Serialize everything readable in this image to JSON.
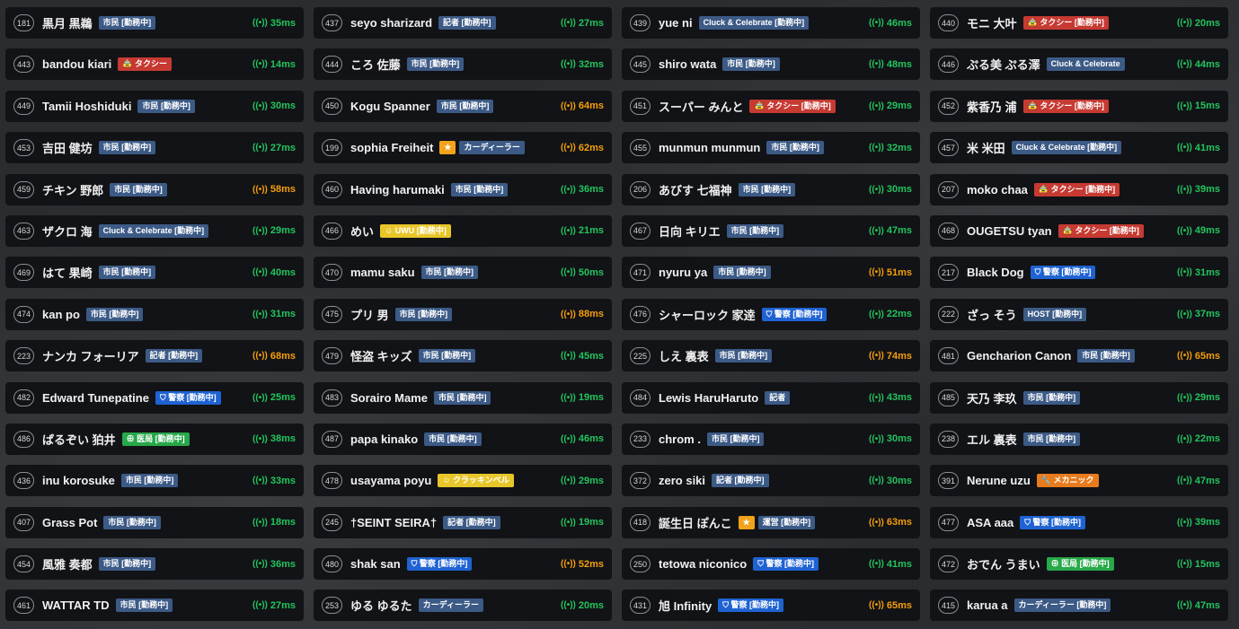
{
  "colors": {
    "bg": "#121316",
    "blue": "#3c5a86",
    "red": "#c63a32",
    "bright": "#1f63d3",
    "green": "#27a84a",
    "yellow": "#e8c62a",
    "orange": "#e87b1d",
    "ping_ok": "#22c55e",
    "ping_warn": "#f59e0b"
  },
  "icons": {
    "signal": "signal-icon",
    "star": "star-icon",
    "taxi": "taxi-icon",
    "shield": "shield-icon",
    "medical": "medical-icon",
    "wrench": "wrench-icon"
  },
  "players": [
    {
      "id": "181",
      "name": "黒月 黒鵜",
      "badges": [
        {
          "text": "市民 [勤務中]",
          "type": "blue"
        }
      ],
      "ping": "35ms",
      "ping_level": "green"
    },
    {
      "id": "437",
      "name": "seyo sharizard",
      "badges": [
        {
          "text": "記者 [勤務中]",
          "type": "blue"
        }
      ],
      "ping": "27ms",
      "ping_level": "green"
    },
    {
      "id": "439",
      "name": "yue ni",
      "badges": [
        {
          "text": "Cluck & Celebrate [勤務中]",
          "type": "blue"
        }
      ],
      "ping": "46ms",
      "ping_level": "green"
    },
    {
      "id": "440",
      "name": "モニ 大叶",
      "badges": [
        {
          "text": "🚖 タクシー [勤務中]",
          "type": "red"
        }
      ],
      "ping": "20ms",
      "ping_level": "green"
    },
    {
      "id": "443",
      "name": "bandou kiari",
      "badges": [
        {
          "text": "🚖 タクシー",
          "type": "red"
        }
      ],
      "ping": "14ms",
      "ping_level": "green"
    },
    {
      "id": "444",
      "name": "ころ 佐藤",
      "badges": [
        {
          "text": "市民 [勤務中]",
          "type": "blue"
        }
      ],
      "ping": "32ms",
      "ping_level": "green"
    },
    {
      "id": "445",
      "name": "shiro wata",
      "badges": [
        {
          "text": "市民 [勤務中]",
          "type": "blue"
        }
      ],
      "ping": "48ms",
      "ping_level": "green"
    },
    {
      "id": "446",
      "name": "ぷる美 ぷる澤",
      "badges": [
        {
          "text": "Cluck & Celebrate",
          "type": "blue"
        }
      ],
      "ping": "44ms",
      "ping_level": "green"
    },
    {
      "id": "449",
      "name": "Tamii Hoshiduki",
      "badges": [
        {
          "text": "市民 [勤務中]",
          "type": "blue"
        }
      ],
      "ping": "30ms",
      "ping_level": "green"
    },
    {
      "id": "450",
      "name": "Kogu Spanner",
      "badges": [
        {
          "text": "市民 [勤務中]",
          "type": "blue"
        }
      ],
      "ping": "64ms",
      "ping_level": "orange"
    },
    {
      "id": "451",
      "name": "スーパー みんと",
      "badges": [
        {
          "text": "🚖 タクシー [勤務中]",
          "type": "red"
        }
      ],
      "ping": "29ms",
      "ping_level": "green"
    },
    {
      "id": "452",
      "name": "紫香乃 浦",
      "badges": [
        {
          "text": "🚖 タクシー [勤務中]",
          "type": "red"
        }
      ],
      "ping": "15ms",
      "ping_level": "green"
    },
    {
      "id": "453",
      "name": "吉田 健坊",
      "badges": [
        {
          "text": "市民 [勤務中]",
          "type": "blue"
        }
      ],
      "ping": "27ms",
      "ping_level": "green"
    },
    {
      "id": "199",
      "name": "sophia Freiheit",
      "badges": [
        {
          "text": "★",
          "type": "gold"
        },
        {
          "text": "カーディーラー",
          "type": "blue"
        }
      ],
      "ping": "62ms",
      "ping_level": "orange"
    },
    {
      "id": "455",
      "name": "munmun munmun",
      "badges": [
        {
          "text": "市民 [勤務中]",
          "type": "blue"
        }
      ],
      "ping": "32ms",
      "ping_level": "green"
    },
    {
      "id": "457",
      "name": "米 米田",
      "badges": [
        {
          "text": "Cluck & Celebrate [勤務中]",
          "type": "blue"
        }
      ],
      "ping": "41ms",
      "ping_level": "green"
    },
    {
      "id": "459",
      "name": "チキン 野郎",
      "badges": [
        {
          "text": "市民 [勤務中]",
          "type": "blue"
        }
      ],
      "ping": "58ms",
      "ping_level": "orange"
    },
    {
      "id": "460",
      "name": "Having harumaki",
      "badges": [
        {
          "text": "市民 [勤務中]",
          "type": "blue"
        }
      ],
      "ping": "36ms",
      "ping_level": "green"
    },
    {
      "id": "206",
      "name": "あびす 七福神",
      "badges": [
        {
          "text": "市民 [勤務中]",
          "type": "blue"
        }
      ],
      "ping": "30ms",
      "ping_level": "green"
    },
    {
      "id": "207",
      "name": "moko chaa",
      "badges": [
        {
          "text": "🚖 タクシー [勤務中]",
          "type": "red"
        }
      ],
      "ping": "39ms",
      "ping_level": "green"
    },
    {
      "id": "463",
      "name": "ザクロ 海",
      "badges": [
        {
          "text": "Cluck & Celebrate [勤務中]",
          "type": "blue"
        }
      ],
      "ping": "29ms",
      "ping_level": "green"
    },
    {
      "id": "466",
      "name": "めい",
      "badges": [
        {
          "text": "☺ UWU [勤務中]",
          "type": "yellow"
        }
      ],
      "ping": "21ms",
      "ping_level": "green"
    },
    {
      "id": "467",
      "name": "日向 キリエ",
      "badges": [
        {
          "text": "市民 [勤務中]",
          "type": "blue"
        }
      ],
      "ping": "47ms",
      "ping_level": "green"
    },
    {
      "id": "468",
      "name": "OUGETSU tyan",
      "badges": [
        {
          "text": "🚖 タクシー [勤務中]",
          "type": "red"
        }
      ],
      "ping": "49ms",
      "ping_level": "green"
    },
    {
      "id": "469",
      "name": "はて 果崎",
      "badges": [
        {
          "text": "市民 [勤務中]",
          "type": "blue"
        }
      ],
      "ping": "40ms",
      "ping_level": "green"
    },
    {
      "id": "470",
      "name": "mamu saku",
      "badges": [
        {
          "text": "市民 [勤務中]",
          "type": "blue"
        }
      ],
      "ping": "50ms",
      "ping_level": "green"
    },
    {
      "id": "471",
      "name": "nyuru ya",
      "badges": [
        {
          "text": "市民 [勤務中]",
          "type": "blue"
        }
      ],
      "ping": "51ms",
      "ping_level": "orange"
    },
    {
      "id": "217",
      "name": "Black Dog",
      "badges": [
        {
          "text": "⛉ 警察 [勤務中]",
          "type": "bright"
        }
      ],
      "ping": "31ms",
      "ping_level": "green"
    },
    {
      "id": "474",
      "name": "kan po",
      "badges": [
        {
          "text": "市民 [勤務中]",
          "type": "blue"
        }
      ],
      "ping": "31ms",
      "ping_level": "green"
    },
    {
      "id": "475",
      "name": "プリ 男",
      "badges": [
        {
          "text": "市民 [勤務中]",
          "type": "blue"
        }
      ],
      "ping": "88ms",
      "ping_level": "orange"
    },
    {
      "id": "476",
      "name": "シャーロック 家逹",
      "badges": [
        {
          "text": "⛉ 警察 [勤務中]",
          "type": "bright"
        }
      ],
      "ping": "22ms",
      "ping_level": "green"
    },
    {
      "id": "222",
      "name": "ざっ そう",
      "badges": [
        {
          "text": "HOST [勤務中]",
          "type": "blue"
        }
      ],
      "ping": "37ms",
      "ping_level": "green"
    },
    {
      "id": "223",
      "name": "ナンカ フォーリア",
      "badges": [
        {
          "text": "記者 [勤務中]",
          "type": "blue"
        }
      ],
      "ping": "68ms",
      "ping_level": "orange"
    },
    {
      "id": "479",
      "name": "怪盗 キッズ",
      "badges": [
        {
          "text": "市民 [勤務中]",
          "type": "blue"
        }
      ],
      "ping": "45ms",
      "ping_level": "green"
    },
    {
      "id": "225",
      "name": "しえ 裏表",
      "badges": [
        {
          "text": "市民 [勤務中]",
          "type": "blue"
        }
      ],
      "ping": "74ms",
      "ping_level": "orange"
    },
    {
      "id": "481",
      "name": "Gencharion Canon",
      "badges": [
        {
          "text": "市民 [勤務中]",
          "type": "blue"
        }
      ],
      "ping": "65ms",
      "ping_level": "orange"
    },
    {
      "id": "482",
      "name": "Edward Tunepatine",
      "badges": [
        {
          "text": "⛉ 警察 [勤務中]",
          "type": "bright"
        }
      ],
      "ping": "25ms",
      "ping_level": "green"
    },
    {
      "id": "483",
      "name": "Sorairo Mame",
      "badges": [
        {
          "text": "市民 [勤務中]",
          "type": "blue"
        }
      ],
      "ping": "19ms",
      "ping_level": "green"
    },
    {
      "id": "484",
      "name": "Lewis HaruHaruto",
      "badges": [
        {
          "text": "記者",
          "type": "blue"
        }
      ],
      "ping": "43ms",
      "ping_level": "green"
    },
    {
      "id": "485",
      "name": "天乃 李玖",
      "badges": [
        {
          "text": "市民 [勤務中]",
          "type": "blue"
        }
      ],
      "ping": "29ms",
      "ping_level": "green"
    },
    {
      "id": "486",
      "name": "ぱるぞい 狛井",
      "badges": [
        {
          "text": "⊕ 医局 [勤務中]",
          "type": "green"
        }
      ],
      "ping": "38ms",
      "ping_level": "green"
    },
    {
      "id": "487",
      "name": "papa kinako",
      "badges": [
        {
          "text": "市民 [勤務中]",
          "type": "blue"
        }
      ],
      "ping": "46ms",
      "ping_level": "green"
    },
    {
      "id": "233",
      "name": "chrom .",
      "badges": [
        {
          "text": "市民 [勤務中]",
          "type": "blue"
        }
      ],
      "ping": "30ms",
      "ping_level": "green"
    },
    {
      "id": "238",
      "name": "エル 裏表",
      "badges": [
        {
          "text": "市民 [勤務中]",
          "type": "blue"
        }
      ],
      "ping": "22ms",
      "ping_level": "green"
    },
    {
      "id": "436",
      "name": "inu korosuke",
      "badges": [
        {
          "text": "市民 [勤務中]",
          "type": "blue"
        }
      ],
      "ping": "33ms",
      "ping_level": "green"
    },
    {
      "id": "478",
      "name": "usayama poyu",
      "badges": [
        {
          "text": "☺ クラッキンベル",
          "type": "yellow"
        }
      ],
      "ping": "29ms",
      "ping_level": "green"
    },
    {
      "id": "372",
      "name": "zero siki",
      "badges": [
        {
          "text": "記者 [勤務中]",
          "type": "blue"
        }
      ],
      "ping": "30ms",
      "ping_level": "green"
    },
    {
      "id": "391",
      "name": "Nerune uzu",
      "badges": [
        {
          "text": "🔧 メカニック",
          "type": "orange"
        }
      ],
      "ping": "47ms",
      "ping_level": "green"
    },
    {
      "id": "407",
      "name": "Grass Pot",
      "badges": [
        {
          "text": "市民 [勤務中]",
          "type": "blue"
        }
      ],
      "ping": "18ms",
      "ping_level": "green"
    },
    {
      "id": "245",
      "name": "†SEINT SEIRA†",
      "badges": [
        {
          "text": "記者 [勤務中]",
          "type": "blue"
        }
      ],
      "ping": "19ms",
      "ping_level": "green"
    },
    {
      "id": "418",
      "name": "誕生日 ぽんこ",
      "badges": [
        {
          "text": "★",
          "type": "gold"
        },
        {
          "text": "運営 [勤務中]",
          "type": "blue"
        }
      ],
      "ping": "63ms",
      "ping_level": "orange"
    },
    {
      "id": "477",
      "name": "ASA aaa",
      "badges": [
        {
          "text": "⛉ 警察 [勤務中]",
          "type": "bright"
        }
      ],
      "ping": "39ms",
      "ping_level": "green"
    },
    {
      "id": "454",
      "name": "風雅 奏都",
      "badges": [
        {
          "text": "市民 [勤務中]",
          "type": "blue"
        }
      ],
      "ping": "36ms",
      "ping_level": "green"
    },
    {
      "id": "480",
      "name": "shak san",
      "badges": [
        {
          "text": "⛉ 警察 [勤務中]",
          "type": "bright"
        }
      ],
      "ping": "52ms",
      "ping_level": "orange"
    },
    {
      "id": "250",
      "name": "tetowa niconico",
      "badges": [
        {
          "text": "⛉ 警察 [勤務中]",
          "type": "bright"
        }
      ],
      "ping": "41ms",
      "ping_level": "green"
    },
    {
      "id": "472",
      "name": "おでん うまい",
      "badges": [
        {
          "text": "⊕ 医局 [勤務中]",
          "type": "green"
        }
      ],
      "ping": "15ms",
      "ping_level": "green"
    },
    {
      "id": "461",
      "name": "WATTAR TD",
      "badges": [
        {
          "text": "市民 [勤務中]",
          "type": "blue"
        }
      ],
      "ping": "27ms",
      "ping_level": "green"
    },
    {
      "id": "253",
      "name": "ゆる ゆるた",
      "badges": [
        {
          "text": "カーディーラー",
          "type": "blue"
        }
      ],
      "ping": "20ms",
      "ping_level": "green"
    },
    {
      "id": "431",
      "name": "旭 Infinity",
      "badges": [
        {
          "text": "⛉ 警察 [勤務中]",
          "type": "bright"
        }
      ],
      "ping": "65ms",
      "ping_level": "orange"
    },
    {
      "id": "415",
      "name": "karua a",
      "badges": [
        {
          "text": "カーディーラー [勤務中]",
          "type": "blue"
        }
      ],
      "ping": "47ms",
      "ping_level": "green"
    }
  ]
}
